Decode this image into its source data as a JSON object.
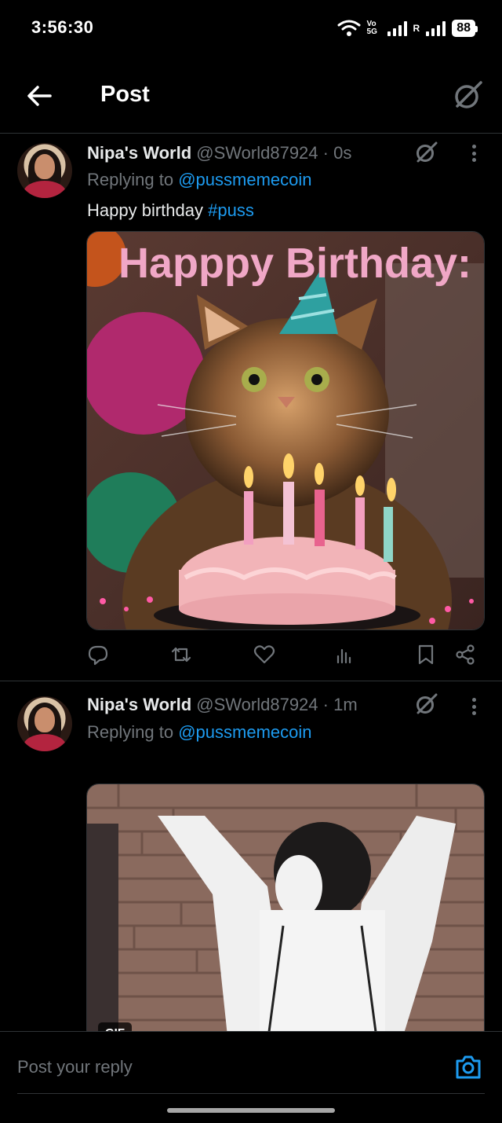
{
  "status_bar": {
    "time": "3:56:30",
    "network_label": "Vo 5G",
    "roaming_label": "R",
    "battery": "88"
  },
  "header": {
    "title": "Post"
  },
  "posts": [
    {
      "author_name": "Nipa's World",
      "author_handle": "@SWorld87924",
      "time_sep": "·",
      "time": "0s",
      "replying_prefix": "Replying to",
      "replying_to": "@pussmemecoin",
      "text": "Happy birthday",
      "hashtag": "#puss",
      "image_caption": "Happpy Birthday:"
    },
    {
      "author_name": "Nipa's World",
      "author_handle": "@SWorld87924",
      "time_sep": "·",
      "time": "1m",
      "replying_prefix": "Replying to",
      "replying_to": "@pussmemecoin",
      "media_badge": "GIF"
    }
  ],
  "reply_bar": {
    "placeholder": "Post your reply"
  },
  "icons": {
    "back": "arrow-left-icon",
    "grok": "grok-icon",
    "more": "more-vertical-icon",
    "reply": "reply-icon",
    "repost": "repost-icon",
    "like": "heart-icon",
    "views": "views-icon",
    "bookmark": "bookmark-icon",
    "share": "share-icon",
    "camera": "camera-icon"
  },
  "colors": {
    "background": "#000000",
    "text": "#e7e9ea",
    "muted": "#71767b",
    "accent": "#1d9bf0",
    "divider": "#2f3336"
  }
}
